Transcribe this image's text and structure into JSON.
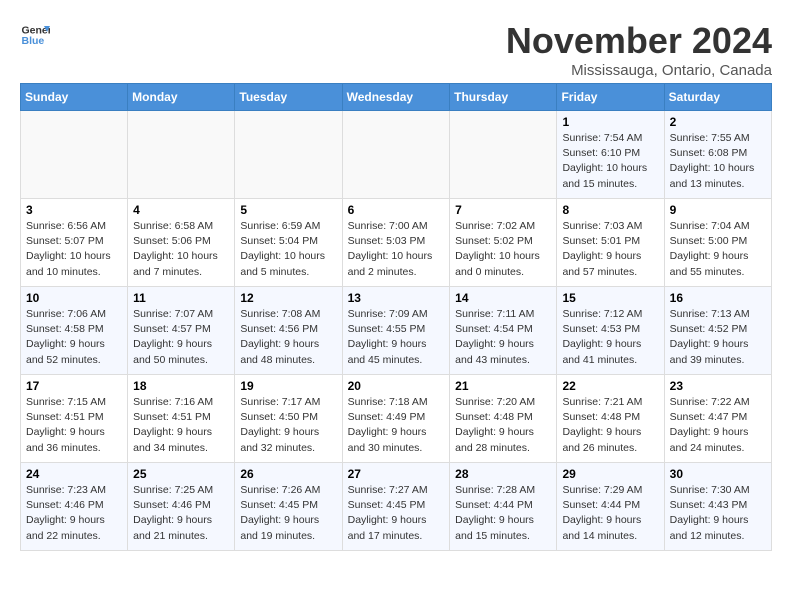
{
  "logo": {
    "line1": "General",
    "line2": "Blue"
  },
  "title": "November 2024",
  "subtitle": "Mississauga, Ontario, Canada",
  "days_of_week": [
    "Sunday",
    "Monday",
    "Tuesday",
    "Wednesday",
    "Thursday",
    "Friday",
    "Saturday"
  ],
  "weeks": [
    [
      {
        "day": "",
        "info": ""
      },
      {
        "day": "",
        "info": ""
      },
      {
        "day": "",
        "info": ""
      },
      {
        "day": "",
        "info": ""
      },
      {
        "day": "",
        "info": ""
      },
      {
        "day": "1",
        "info": "Sunrise: 7:54 AM\nSunset: 6:10 PM\nDaylight: 10 hours and 15 minutes."
      },
      {
        "day": "2",
        "info": "Sunrise: 7:55 AM\nSunset: 6:08 PM\nDaylight: 10 hours and 13 minutes."
      }
    ],
    [
      {
        "day": "3",
        "info": "Sunrise: 6:56 AM\nSunset: 5:07 PM\nDaylight: 10 hours and 10 minutes."
      },
      {
        "day": "4",
        "info": "Sunrise: 6:58 AM\nSunset: 5:06 PM\nDaylight: 10 hours and 7 minutes."
      },
      {
        "day": "5",
        "info": "Sunrise: 6:59 AM\nSunset: 5:04 PM\nDaylight: 10 hours and 5 minutes."
      },
      {
        "day": "6",
        "info": "Sunrise: 7:00 AM\nSunset: 5:03 PM\nDaylight: 10 hours and 2 minutes."
      },
      {
        "day": "7",
        "info": "Sunrise: 7:02 AM\nSunset: 5:02 PM\nDaylight: 10 hours and 0 minutes."
      },
      {
        "day": "8",
        "info": "Sunrise: 7:03 AM\nSunset: 5:01 PM\nDaylight: 9 hours and 57 minutes."
      },
      {
        "day": "9",
        "info": "Sunrise: 7:04 AM\nSunset: 5:00 PM\nDaylight: 9 hours and 55 minutes."
      }
    ],
    [
      {
        "day": "10",
        "info": "Sunrise: 7:06 AM\nSunset: 4:58 PM\nDaylight: 9 hours and 52 minutes."
      },
      {
        "day": "11",
        "info": "Sunrise: 7:07 AM\nSunset: 4:57 PM\nDaylight: 9 hours and 50 minutes."
      },
      {
        "day": "12",
        "info": "Sunrise: 7:08 AM\nSunset: 4:56 PM\nDaylight: 9 hours and 48 minutes."
      },
      {
        "day": "13",
        "info": "Sunrise: 7:09 AM\nSunset: 4:55 PM\nDaylight: 9 hours and 45 minutes."
      },
      {
        "day": "14",
        "info": "Sunrise: 7:11 AM\nSunset: 4:54 PM\nDaylight: 9 hours and 43 minutes."
      },
      {
        "day": "15",
        "info": "Sunrise: 7:12 AM\nSunset: 4:53 PM\nDaylight: 9 hours and 41 minutes."
      },
      {
        "day": "16",
        "info": "Sunrise: 7:13 AM\nSunset: 4:52 PM\nDaylight: 9 hours and 39 minutes."
      }
    ],
    [
      {
        "day": "17",
        "info": "Sunrise: 7:15 AM\nSunset: 4:51 PM\nDaylight: 9 hours and 36 minutes."
      },
      {
        "day": "18",
        "info": "Sunrise: 7:16 AM\nSunset: 4:51 PM\nDaylight: 9 hours and 34 minutes."
      },
      {
        "day": "19",
        "info": "Sunrise: 7:17 AM\nSunset: 4:50 PM\nDaylight: 9 hours and 32 minutes."
      },
      {
        "day": "20",
        "info": "Sunrise: 7:18 AM\nSunset: 4:49 PM\nDaylight: 9 hours and 30 minutes."
      },
      {
        "day": "21",
        "info": "Sunrise: 7:20 AM\nSunset: 4:48 PM\nDaylight: 9 hours and 28 minutes."
      },
      {
        "day": "22",
        "info": "Sunrise: 7:21 AM\nSunset: 4:48 PM\nDaylight: 9 hours and 26 minutes."
      },
      {
        "day": "23",
        "info": "Sunrise: 7:22 AM\nSunset: 4:47 PM\nDaylight: 9 hours and 24 minutes."
      }
    ],
    [
      {
        "day": "24",
        "info": "Sunrise: 7:23 AM\nSunset: 4:46 PM\nDaylight: 9 hours and 22 minutes."
      },
      {
        "day": "25",
        "info": "Sunrise: 7:25 AM\nSunset: 4:46 PM\nDaylight: 9 hours and 21 minutes."
      },
      {
        "day": "26",
        "info": "Sunrise: 7:26 AM\nSunset: 4:45 PM\nDaylight: 9 hours and 19 minutes."
      },
      {
        "day": "27",
        "info": "Sunrise: 7:27 AM\nSunset: 4:45 PM\nDaylight: 9 hours and 17 minutes."
      },
      {
        "day": "28",
        "info": "Sunrise: 7:28 AM\nSunset: 4:44 PM\nDaylight: 9 hours and 15 minutes."
      },
      {
        "day": "29",
        "info": "Sunrise: 7:29 AM\nSunset: 4:44 PM\nDaylight: 9 hours and 14 minutes."
      },
      {
        "day": "30",
        "info": "Sunrise: 7:30 AM\nSunset: 4:43 PM\nDaylight: 9 hours and 12 minutes."
      }
    ]
  ]
}
